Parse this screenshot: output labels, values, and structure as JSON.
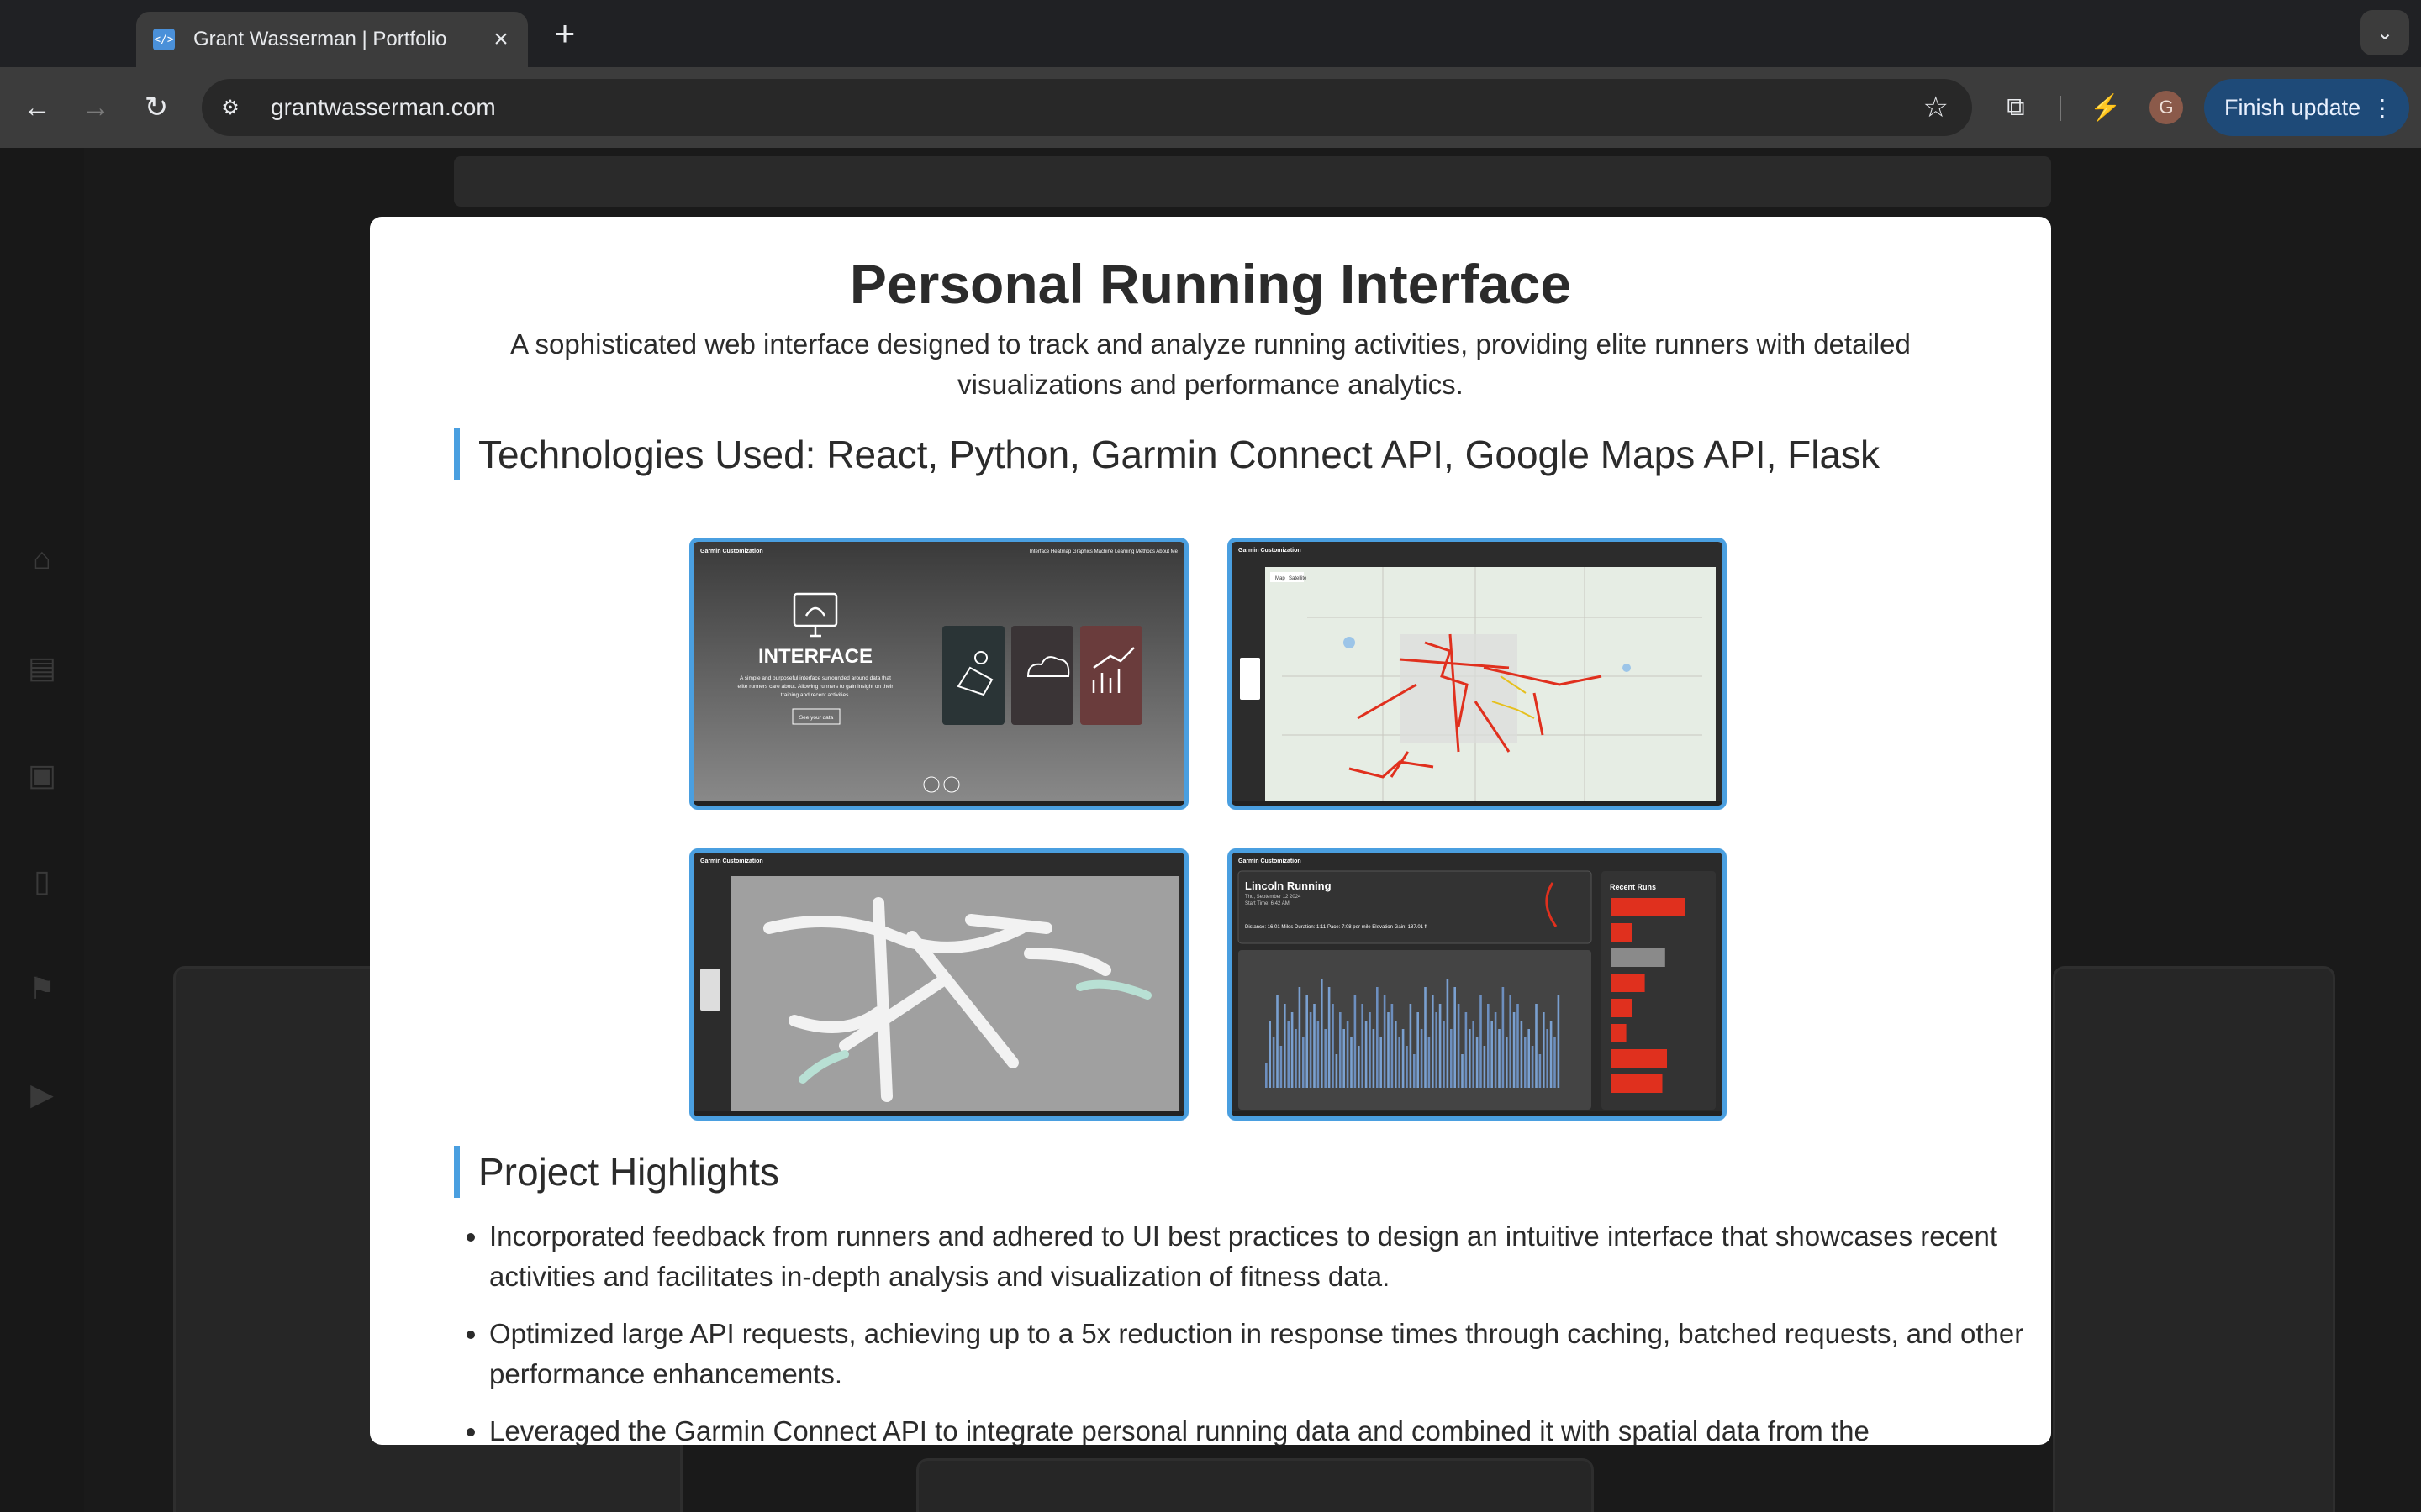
{
  "browser": {
    "tab_title": "Grant Wasserman | Portfolio",
    "url": "grantwasserman.com",
    "finish_update_label": "Finish update",
    "avatar_letter": "G"
  },
  "modal": {
    "title": "Personal Running Interface",
    "description": "A sophisticated web interface designed to track and analyze running activities, providing elite runners with detailed visualizations and performance analytics.",
    "technologies_heading": "Technologies Used: React, Python, Garmin Connect API, Google Maps API, Flask",
    "highlights_heading": "Project Highlights",
    "highlights": [
      "Incorporated feedback from runners and adhered to UI best practices to design an intuitive interface that showcases recent activities and facilitates in-depth analysis and visualization of fitness data.",
      "Optimized large API requests, achieving up to a 5x reduction in response times through caching, batched requests, and other performance enhancements.",
      "Leveraged the Garmin Connect API to integrate personal running data and combined it with spatial data from the"
    ]
  },
  "screenshots": {
    "brand": "Garmin Customization",
    "nav": "Interface  Heatmap  Graphics  Machine Learning  Methods  About Me",
    "interface_heading": "INTERFACE",
    "interface_text_1": "A simple and purposeful interface surrounded around data that",
    "interface_text_2": "elite runners care about. Allowing runners to gain insight on their",
    "interface_text_3": "training and recent activities.",
    "interface_button": "See your data",
    "run_title": "Lincoln Running",
    "run_date": "Thu, September 12 2024",
    "run_start": "Start Time: 6:42 AM",
    "run_stats": "Distance: 16.01 Miles   Duration: 1:11   Pace: 7:08 per mile   Elevation Gain: 187.01 ft",
    "recent_runs": "Recent Runs",
    "map_tab_map": "Map",
    "map_tab_sat": "Satellite",
    "recent_run_levels": [
      0.8,
      0.22,
      0.58,
      0.36,
      0.22,
      0.16,
      0.6,
      0.55
    ]
  },
  "colors": {
    "accent_border": "#4a9fe0",
    "finish_update_bg": "#1e4a78",
    "run_route": "#e0301e"
  }
}
